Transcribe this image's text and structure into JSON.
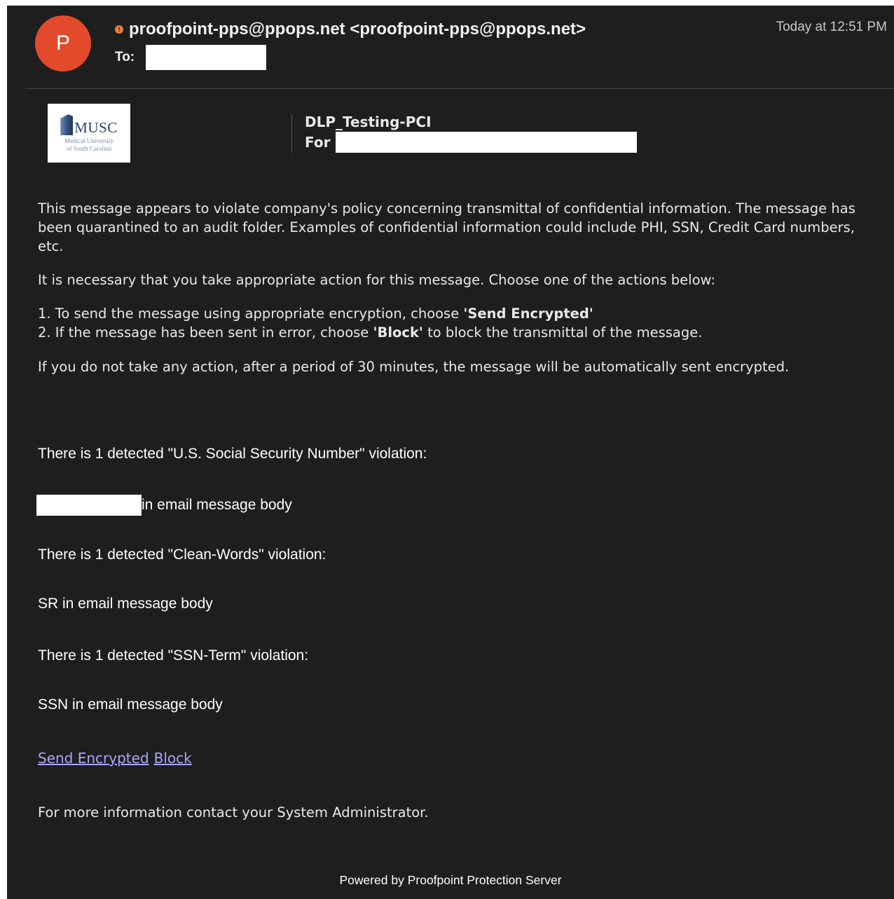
{
  "header": {
    "avatar_initial": "P",
    "priority_glyph": "!",
    "from": "proofpoint-pps@ppops.net <proofpoint-pps@ppops.net>",
    "to_label": "To:",
    "timestamp": "Today at 12:51 PM"
  },
  "logo": {
    "name": "MUSC",
    "sub_line1": "Medical University",
    "sub_line2": "of South Carolina"
  },
  "policy": {
    "name": "DLP_Testing-PCI",
    "for_label": "For"
  },
  "body": {
    "intro": "This message appears to violate company's policy concerning transmittal of confidential information. The message has been quarantined to an audit folder. Examples of confidential information could include PHI, SSN, Credit Card numbers, etc.",
    "action_instruction": "It is necessary that you take appropriate action for this message. Choose one of the actions below:",
    "option1_prefix": "1. To send the message using appropriate encryption, choose ",
    "option1_keyword": "'Send Encrypted'",
    "option2_prefix": "2. If the message has been sent in error, choose ",
    "option2_keyword": "'Block'",
    "option2_suffix": " to block the transmittal of the message.",
    "auto_note": "If you do not take any action, after a period of 30 minutes, the message will be automatically sent encrypted."
  },
  "violations": [
    {
      "title": "There is 1 detected \"U.S. Social Security Number\" violation:",
      "detail": "in email message body"
    },
    {
      "title": "There is 1 detected \"Clean-Words\" violation:",
      "detail": "SR in email message body"
    },
    {
      "title": "There is 1 detected \"SSN-Term\" violation:",
      "detail": "SSN in email message body"
    }
  ],
  "actions": {
    "send_encrypted": "Send Encrypted",
    "block": "Block"
  },
  "contact": "For more information contact your System Administrator.",
  "footer": "Powered by Proofpoint Protection Server",
  "colors": {
    "background": "#1e1e1e",
    "avatar": "#e34a2c",
    "link": "#a9a6ff",
    "priority": "#e8803a"
  }
}
